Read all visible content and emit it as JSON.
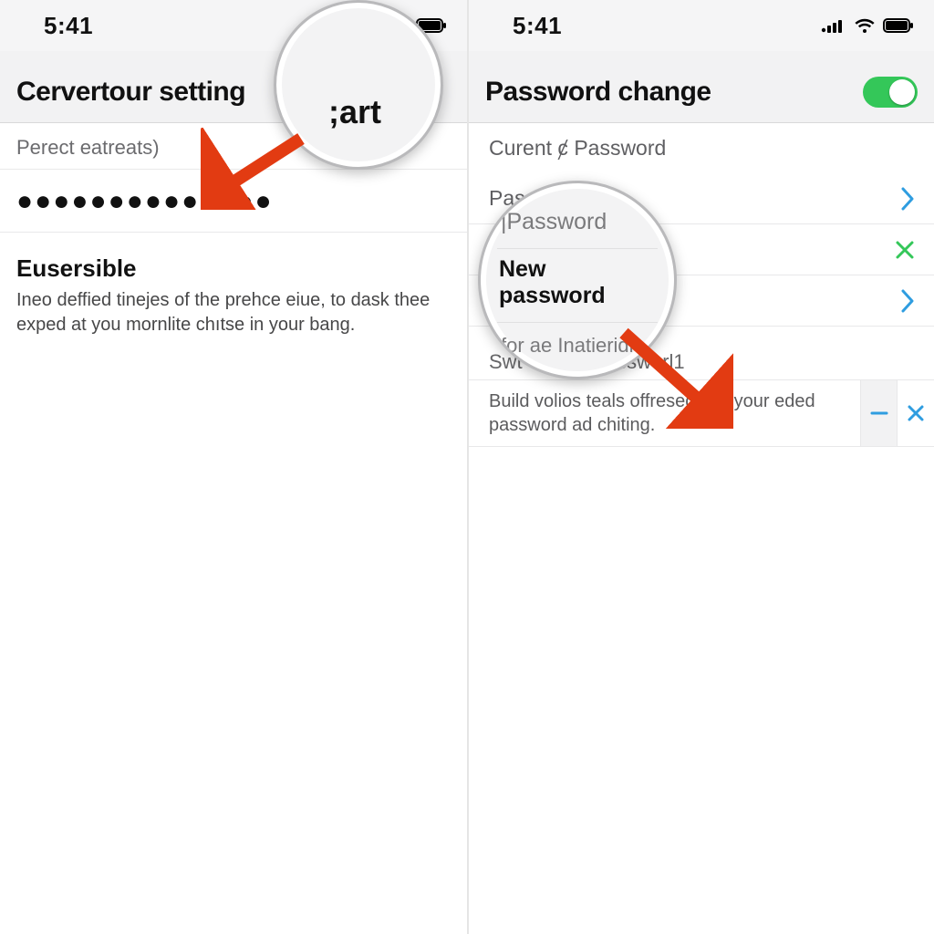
{
  "status": {
    "time": "5:41"
  },
  "left": {
    "title": "Cervertour setting",
    "field_label": "Perect eatreats)",
    "password_mask": "●●●●●●●●●●●●●●",
    "section_title": "Eusersible",
    "section_desc": "Ineo deffied tinejes of the prehce eiue, to dask thee exped at you mornlite chıtse in your bang.",
    "magnifier_text": ";art"
  },
  "right": {
    "title": "Password change",
    "toggle_on": true,
    "rows": {
      "current_label": "Curent ȼ Password",
      "password_label": "Password",
      "new_password_label": "New password",
      "confirm_label": "for ae Inatieridr"
    },
    "switch_label": "Swtˈəˈʰour| passworl1",
    "tip_text": "Build volios teals offresed this your eded password ad chiting.",
    "magnifier": {
      "line1": "|Password",
      "line2": "New password",
      "line3": "for ae Inatieridr"
    }
  },
  "colors": {
    "accent_blue": "#2f9de0",
    "accent_green": "#34c759",
    "arrow_red": "#e23b12"
  }
}
